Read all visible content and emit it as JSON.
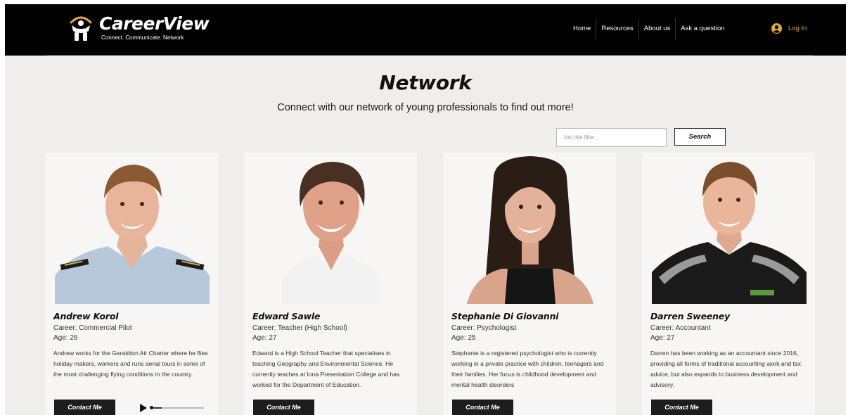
{
  "header": {
    "brand": "CareerView",
    "tagline": "Connect. Communicate. Network",
    "nav": [
      "Home",
      "Resources",
      "About us",
      "Ask a question"
    ],
    "login_label": "Log In"
  },
  "page": {
    "title": "Network",
    "subtitle": "Connect with our network of young professionals to find out more!",
    "filter_placeholder": "Job title filter...",
    "search_label": "Search"
  },
  "cards": [
    {
      "name": "Andrew Korol",
      "career": "Career: Commercial Pilot",
      "age": "Age: 26",
      "bio": "Andrew works for the Geraldton Air Charter where he flies holiday makers, workers and runs aerial tours in some of the most challenging flying conditions in the country.",
      "contact_label": "Contact Me",
      "audio_progress": 0.2
    },
    {
      "name": "Edward Sawle",
      "career": "Career: Teacher (High School)",
      "age": "Age: 27",
      "bio": "Edward is a High School Teacher that specialises in teaching Geography and Environmental Science. He currently teaches at Iona Presentation College and has worked for the Department of Education.",
      "contact_label": "Contact Me"
    },
    {
      "name": "Stephanie Di Giovanni",
      "career": "Career: Psychologist",
      "age": "Age: 25",
      "bio": "Stephanie is a registered psychologist who is currently working in a private practice with children, teenagers and their families. Her focus is childhood development and mental health disorders",
      "contact_label": "Contact Me"
    },
    {
      "name": "Darren Sweeney",
      "career": "Career: Accountant",
      "age": "Age: 27",
      "bio": "Darren has been working as an accountant since 2016, providing all forms of traditional accounting work and tax advice, but also expands to business development and advisory.",
      "contact_label": "Contact Me"
    }
  ],
  "colors": {
    "header_bg": "#000000",
    "page_bg": "#f0eeeb",
    "card_bg": "#f7f6f4",
    "accent": "#e7a93a",
    "button_bg": "#1d1d1d"
  }
}
